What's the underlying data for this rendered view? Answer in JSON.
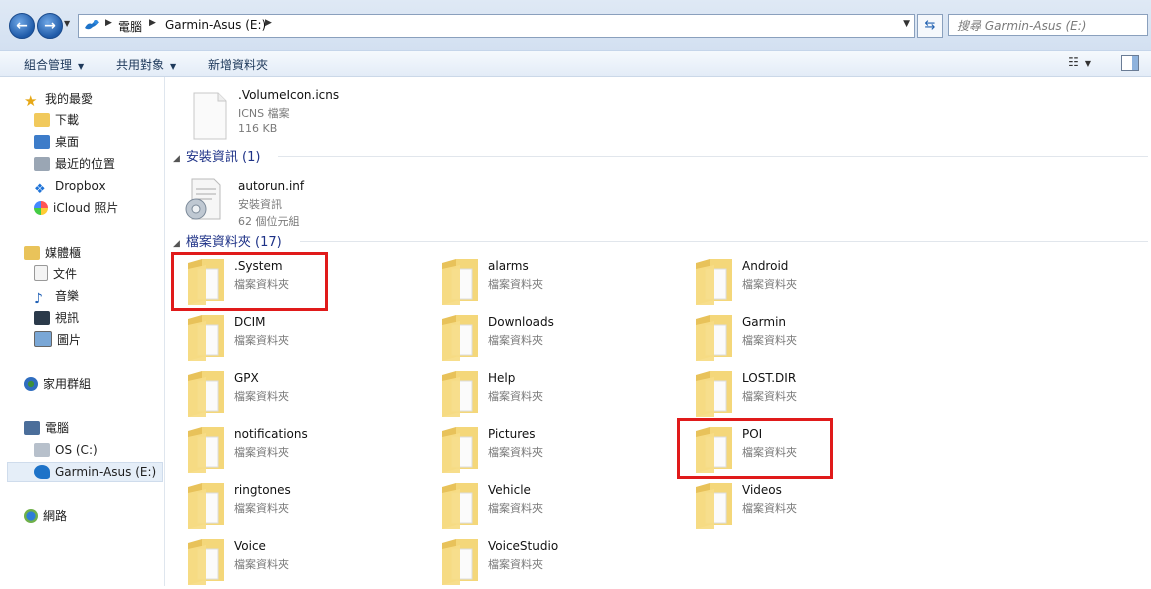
{
  "address_bar": {
    "crumbs": [
      "電腦",
      "Garmin-Asus (E:)"
    ],
    "search_placeholder": "搜尋 Garmin-Asus (E:)"
  },
  "toolbar": {
    "organize": "組合管理",
    "share": "共用對象",
    "new_folder": "新增資料夾"
  },
  "sidebar": {
    "favorites": {
      "label": "我的最愛",
      "items": [
        "下載",
        "桌面",
        "最近的位置",
        "Dropbox",
        "iCloud 照片"
      ]
    },
    "libraries": {
      "label": "媒體櫃",
      "items": [
        "文件",
        "音樂",
        "視訊",
        "圖片"
      ]
    },
    "homegroup": {
      "label": "家用群組"
    },
    "computer": {
      "label": "電腦",
      "items": [
        "OS (C:)",
        "Garmin-Asus (E:)"
      ],
      "selected": "Garmin-Asus (E:)"
    },
    "network": {
      "label": "網路"
    }
  },
  "top_file": {
    "name": ".VolumeIcon.icns",
    "type": "ICNS 檔案",
    "size": "116 KB"
  },
  "setup_group": {
    "header": "安裝資訊 (1)",
    "file": {
      "name": "autorun.inf",
      "type": "安裝資訊",
      "size": "62 個位元組"
    }
  },
  "folder_group": {
    "header": "檔案資料夾 (17)",
    "folder_type": "檔案資料夾",
    "folders": [
      ".System",
      "alarms",
      "Android",
      "DCIM",
      "Downloads",
      "Garmin",
      "GPX",
      "Help",
      "LOST.DIR",
      "notifications",
      "Pictures",
      "POI",
      "ringtones",
      "Vehicle",
      "Videos",
      "Voice",
      "VoiceStudio"
    ],
    "highlighted": [
      ".System",
      "POI"
    ]
  },
  "colors": {
    "highlight": "#e01a1a",
    "folder": "#f4d77a",
    "group_header": "#1e3287"
  }
}
